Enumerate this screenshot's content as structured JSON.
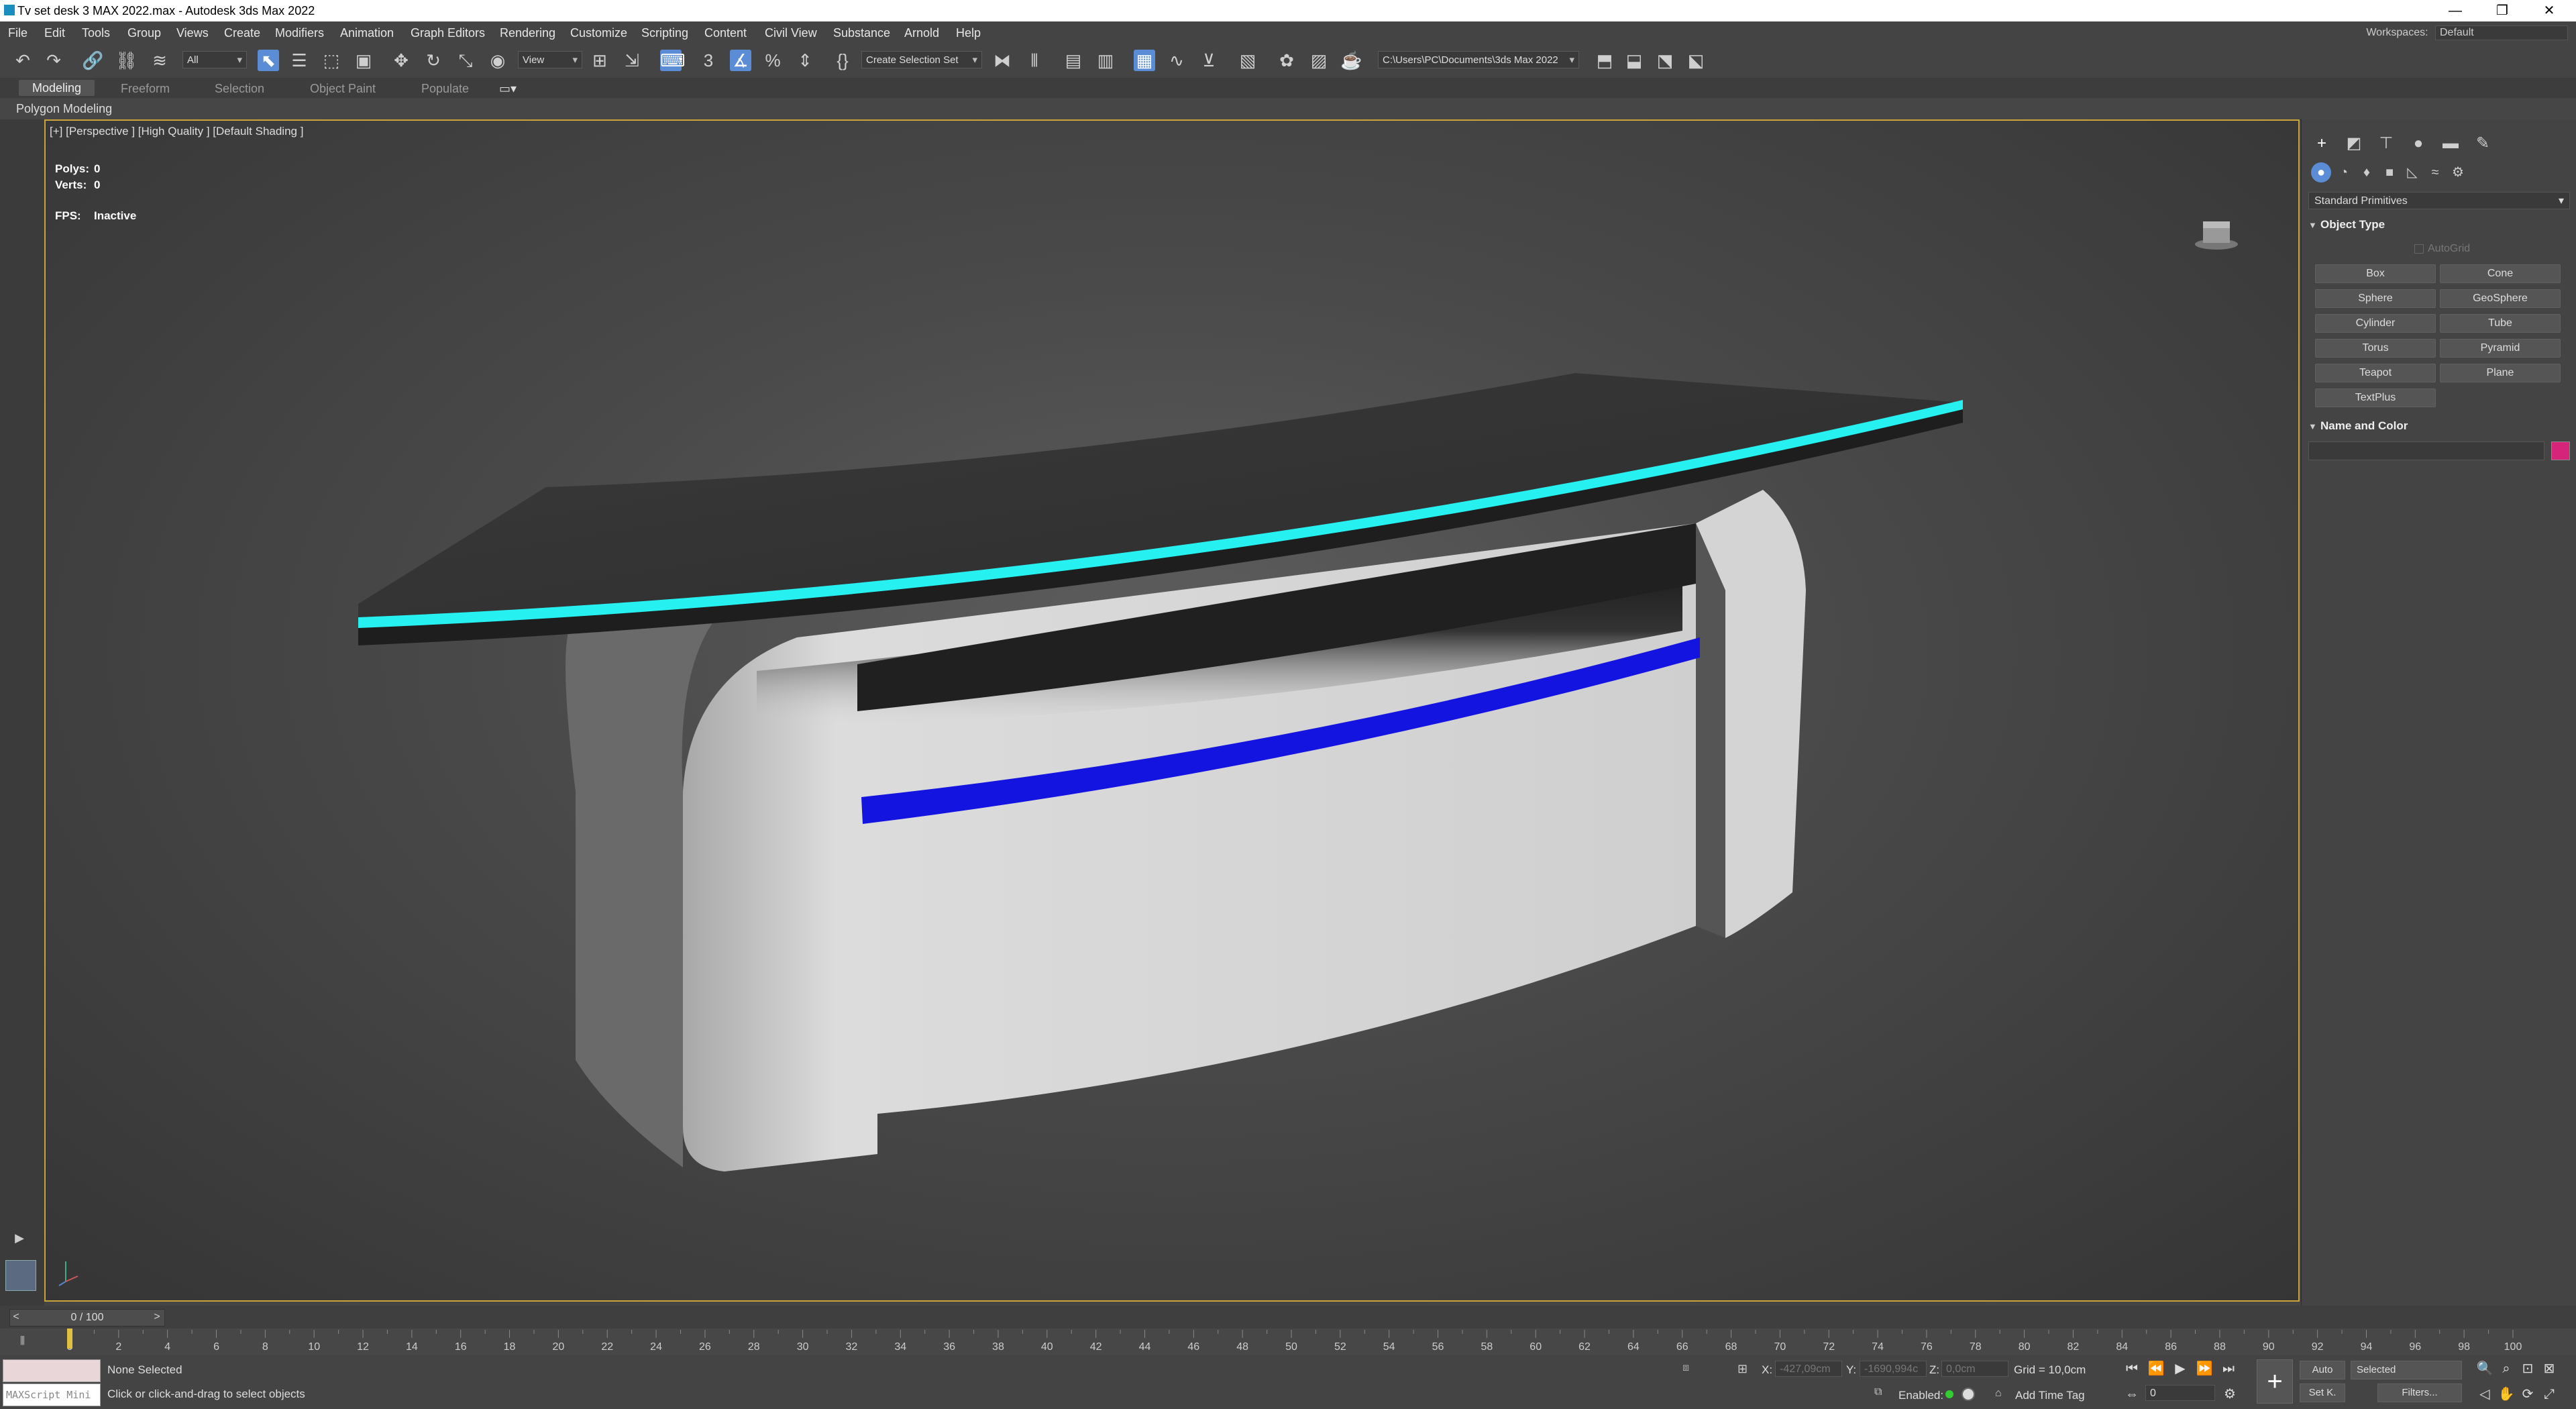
{
  "window": {
    "title": "Tv set desk 3 MAX 2022.max - Autodesk 3ds Max 2022",
    "minimize": "—",
    "restore": "❐",
    "close": "✕"
  },
  "menubar": {
    "items": [
      "File",
      "Edit",
      "Tools",
      "Group",
      "Views",
      "Create",
      "Modifiers",
      "Animation",
      "Graph Editors",
      "Rendering",
      "Customize",
      "Scripting",
      "Content",
      "Civil View",
      "Substance",
      "Arnold",
      "Help"
    ],
    "workspaces_label": "Workspaces:",
    "workspaces_value": "Default"
  },
  "toolbar": {
    "selection_filter": "All",
    "ref_coord": "View",
    "named_selection": "Create Selection Set",
    "project_path": "C:\\Users\\PC\\Documents\\3ds Max 2022",
    "snap_label": "3"
  },
  "ribbon": {
    "tabs": [
      "Modeling",
      "Freeform",
      "Selection",
      "Object Paint",
      "Populate"
    ],
    "active_tab": "Modeling",
    "sub_label": "Polygon Modeling"
  },
  "viewport": {
    "label": "[+] [Perspective ] [High Quality ] [Default Shading ]",
    "polys_label": "Polys:",
    "polys_value": "0",
    "verts_label": "Verts:",
    "verts_value": "0",
    "fps_label": "FPS:",
    "fps_value": "Inactive"
  },
  "command_panel": {
    "primitive_type": "Standard Primitives",
    "object_type_title": "Object Type",
    "autogrid_label": "AutoGrid",
    "buttons": [
      "Box",
      "Cone",
      "Sphere",
      "GeoSphere",
      "Cylinder",
      "Tube",
      "Torus",
      "Pyramid",
      "Teapot",
      "Plane",
      "TextPlus"
    ],
    "name_color_title": "Name and Color",
    "object_color": "#d6247a"
  },
  "timeline": {
    "frame_display": "0 / 100",
    "ticks": [
      "0",
      "2",
      "4",
      "6",
      "8",
      "10",
      "12",
      "14",
      "16",
      "18",
      "20",
      "22",
      "24",
      "26",
      "28",
      "30",
      "32",
      "34",
      "36",
      "38",
      "40",
      "42",
      "44",
      "46",
      "48",
      "50",
      "52",
      "54",
      "56",
      "58",
      "60",
      "62",
      "64",
      "66",
      "68",
      "70",
      "72",
      "74",
      "76",
      "78",
      "80",
      "82",
      "84",
      "86",
      "88",
      "90",
      "92",
      "94",
      "96",
      "98",
      "100"
    ]
  },
  "status": {
    "maxscript_placeholder": "MAXScript Mini",
    "selection_status": "None Selected",
    "prompt": "Click or click-and-drag to select objects",
    "x_label": "X:",
    "x_value": "-427,09cm",
    "y_label": "Y:",
    "y_value": "-1690,994c",
    "z_label": "Z:",
    "z_value": "0,0cm",
    "grid": "Grid = 10,0cm",
    "enabled_label": "Enabled:",
    "add_time_tag": "Add Time Tag",
    "auto_key": "Auto",
    "set_key": "Set K.",
    "key_filter_dd": "Selected",
    "filters": "Filters...",
    "current_frame": "0"
  }
}
